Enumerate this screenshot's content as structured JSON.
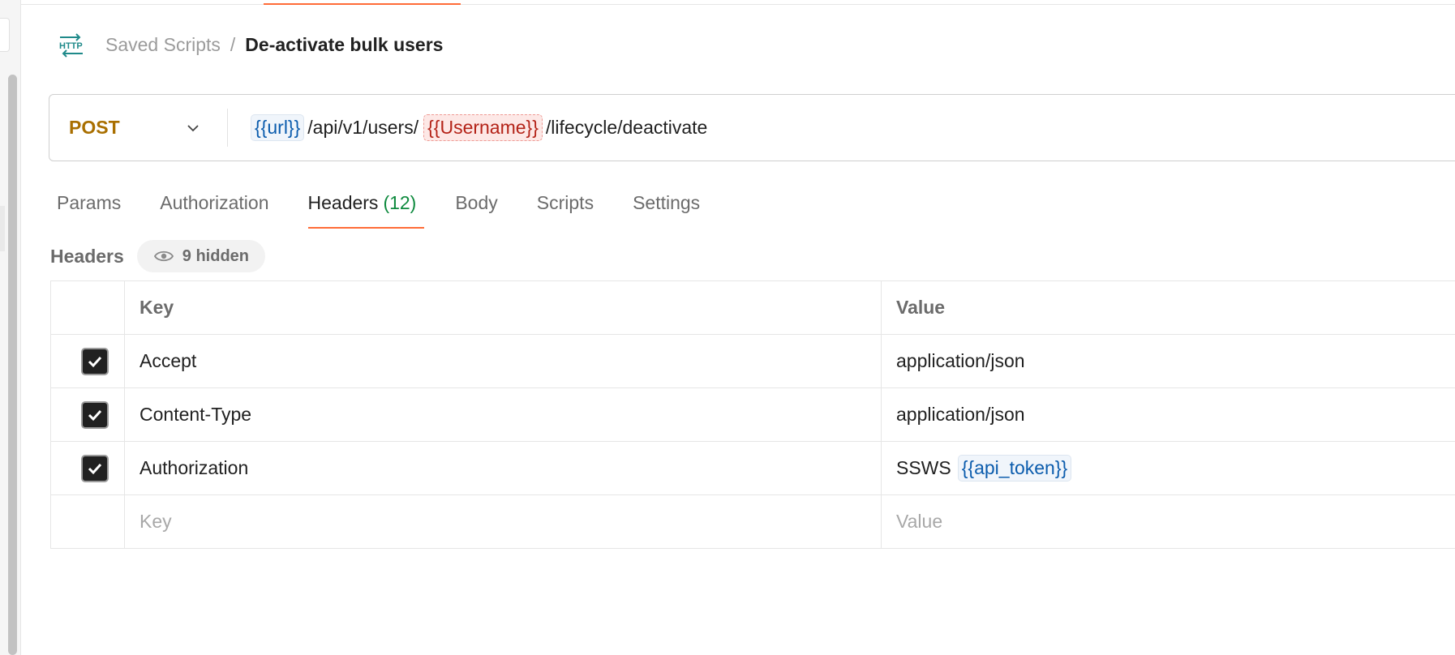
{
  "breadcrumb": {
    "icon": "http-icon",
    "parent": "Saved Scripts",
    "separator": "/",
    "current": "De-activate bulk users"
  },
  "request": {
    "method": "POST",
    "url_parts": {
      "var_url": "{{url}}",
      "path1": "/api/v1/users/",
      "var_username": "{{Username}}",
      "path2": "/lifecycle/deactivate"
    }
  },
  "tabs": [
    {
      "label": "Params"
    },
    {
      "label": "Authorization"
    },
    {
      "label": "Headers",
      "count": "(12)",
      "active": true
    },
    {
      "label": "Body"
    },
    {
      "label": "Scripts"
    },
    {
      "label": "Settings"
    }
  ],
  "headers_section": {
    "title": "Headers",
    "hidden_label": "9 hidden"
  },
  "table": {
    "columns": {
      "key": "Key",
      "value": "Value"
    },
    "rows": [
      {
        "checked": true,
        "key": "Accept",
        "value": "application/json"
      },
      {
        "checked": true,
        "key": "Content-Type",
        "value": "application/json"
      },
      {
        "checked": true,
        "key": "Authorization",
        "value_prefix": "SSWS",
        "value_var": "{{api_token}}"
      }
    ],
    "placeholder": {
      "key": "Key",
      "value": "Value"
    }
  },
  "colors": {
    "accent": "#ff6c37",
    "method": "#a96f00",
    "variable": "#0b5cad",
    "unresolved_variable": "#b42318",
    "count": "#0e8a3e"
  }
}
